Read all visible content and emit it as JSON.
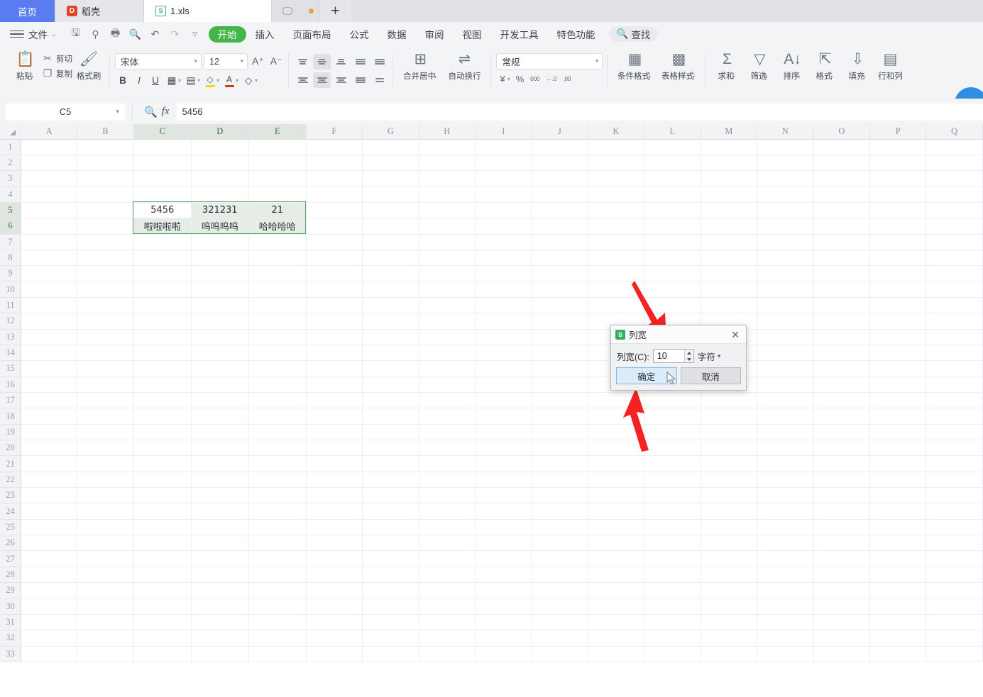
{
  "tabbar": {
    "home_label": "首页",
    "docer_label": "稻壳",
    "docer_icon": "docer-logo-icon",
    "doc_label": "1.xls",
    "doc_icon": "xls-file-icon",
    "screen_icon": "present-icon",
    "dot_icon": "unsaved-dot-icon",
    "plus_label": "+"
  },
  "menu": {
    "file_label": "文件",
    "file_caret": "⌄",
    "quick_access": [
      {
        "name": "save-icon",
        "glyph": "🖫"
      },
      {
        "name": "cloud-sync-icon",
        "glyph": "⚲"
      },
      {
        "name": "print-icon",
        "glyph": "🖶"
      },
      {
        "name": "print-preview-icon",
        "glyph": "🔍"
      },
      {
        "name": "undo-icon",
        "glyph": "↶"
      },
      {
        "name": "redo-icon",
        "glyph": "↷"
      },
      {
        "name": "qat-more-icon",
        "glyph": "⌄"
      }
    ],
    "tabs": [
      {
        "label": "开始",
        "active": true
      },
      {
        "label": "插入",
        "active": false
      },
      {
        "label": "页面布局",
        "active": false
      },
      {
        "label": "公式",
        "active": false
      },
      {
        "label": "数据",
        "active": false
      },
      {
        "label": "审阅",
        "active": false
      },
      {
        "label": "视图",
        "active": false
      },
      {
        "label": "开发工具",
        "active": false
      },
      {
        "label": "特色功能",
        "active": false
      }
    ],
    "find_label": "查找",
    "find_icon": "search-icon"
  },
  "ribbon": {
    "paste_label": "粘贴",
    "cut_label": "剪切",
    "copy_label": "复制",
    "format_painter_label": "格式刷",
    "font_name": "宋体",
    "font_size": "12",
    "grow_font": "A",
    "shrink_font": "A",
    "bold": "B",
    "italic": "I",
    "underline": "U",
    "merge_center_label": "合并居中",
    "wrap_text_label": "自动换行",
    "number_format": "常规",
    "currency": "¥",
    "percent": "%",
    "comma": "000",
    "inc_dec": "←.0",
    "dec_dec": ".00",
    "conditional_format_label": "条件格式",
    "table_style_label": "表格样式",
    "sum_label": "求和",
    "filter_label": "筛选",
    "sort_label": "排序",
    "format_label": "格式",
    "fill_label": "填充",
    "rowcol_label": "行和列"
  },
  "formula_bar": {
    "name_box": "C5",
    "name_caret": "▾",
    "zoom_icon": "zoom-search-icon",
    "fx_label": "fx",
    "value": "5456"
  },
  "grid": {
    "columns": [
      "A",
      "B",
      "C",
      "D",
      "E",
      "F",
      "G",
      "H",
      "I",
      "J",
      "K",
      "L",
      "M",
      "N",
      "O",
      "P",
      "Q"
    ],
    "selected_columns": [
      "C",
      "D",
      "E"
    ],
    "rows": [
      1,
      2,
      3,
      4,
      5,
      6,
      7,
      8,
      9,
      10,
      11,
      12,
      13,
      14,
      15,
      16,
      17,
      18,
      19,
      20,
      21,
      22,
      23,
      24,
      25,
      26,
      27,
      28,
      29,
      30,
      31,
      32,
      33
    ],
    "selected_rows": [
      5,
      6
    ],
    "active_cell": "C5",
    "selection_range": "C5:E6",
    "data": {
      "C5": "5456",
      "D5": "321231",
      "E5": "21",
      "C6": "啦啦啦啦",
      "D6": "呜呜呜呜",
      "E6": "哈哈哈哈"
    }
  },
  "dialog": {
    "icon": "wps-spreadsheet-icon",
    "title": "列宽",
    "close_label": "✕",
    "field_label": "列宽(C):",
    "field_value": "10",
    "unit_label": "字符",
    "unit_caret": "▾",
    "ok_label": "确定",
    "cancel_label": "取消"
  },
  "annotations": {
    "arrow_color": "#f42222",
    "arrow_top_name": "annotation-arrow-to-dialog",
    "arrow_bottom_name": "annotation-arrow-to-ok-button"
  }
}
